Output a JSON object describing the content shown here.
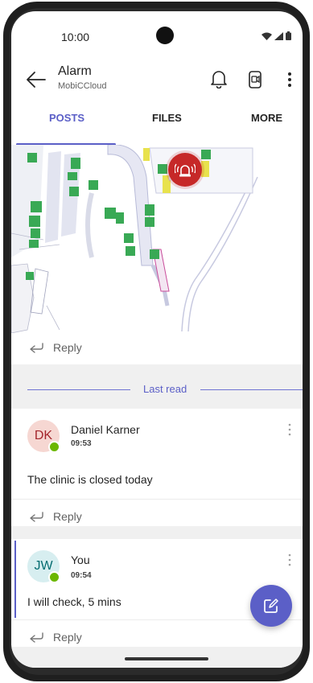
{
  "status_bar": {
    "time": "10:00"
  },
  "header": {
    "title": "Alarm",
    "subtitle": "MobiCCloud"
  },
  "tabs": [
    {
      "label": "POSTS",
      "active": true
    },
    {
      "label": "FILES",
      "active": false
    },
    {
      "label": "MORE",
      "active": false
    }
  ],
  "map_post": {
    "reply_label": "Reply"
  },
  "last_read": {
    "label": "Last read"
  },
  "messages": [
    {
      "initials": "DK",
      "author": "Daniel Karner",
      "time": "09:53",
      "body": "The clinic is closed today",
      "reply_label": "Reply",
      "avatar_bg": "#f6d7d2",
      "avatar_fg": "#a4262c",
      "presence": "available"
    },
    {
      "initials": "JW",
      "author": "You",
      "time": "09:54",
      "body": "I will check, 5 mins",
      "reply_label": "Reply",
      "avatar_bg": "#d7eef0",
      "avatar_fg": "#036c70",
      "presence": "available"
    }
  ],
  "colors": {
    "accent": "#5b5fc7",
    "alarm_red": "#c62828",
    "presence_green": "#6bb700",
    "background_gap": "#f0f0f0"
  },
  "icons": {
    "back": "back-arrow-icon",
    "bell": "bell-icon",
    "call": "video-call-icon",
    "more": "more-vertical-icon",
    "alarm": "alarm-icon",
    "reply": "reply-icon",
    "compose": "compose-icon"
  }
}
